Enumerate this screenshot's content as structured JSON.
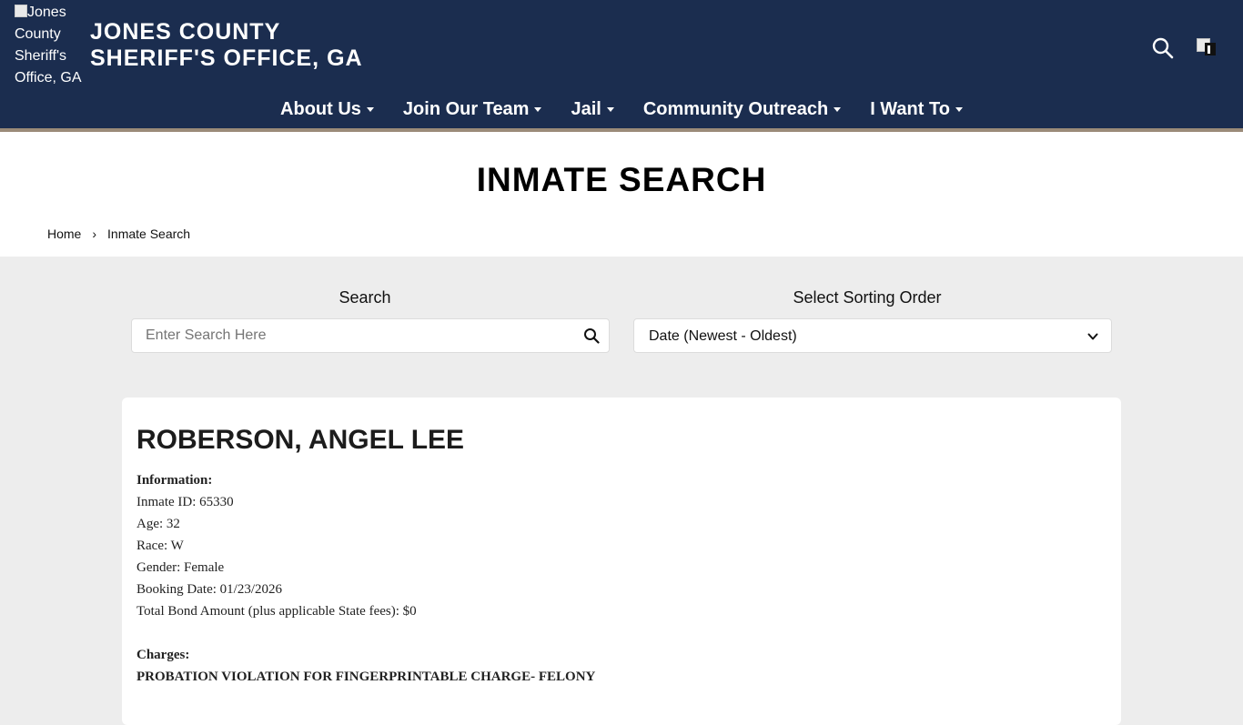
{
  "header": {
    "logo_alt": "Jones County Sheriff's Office, GA",
    "title_line1": "JONES COUNTY",
    "title_line2": "SHERIFF'S OFFICE, GA",
    "search_icon": "search-icon",
    "flag_icon": "broken-image-icon"
  },
  "nav": {
    "items": [
      {
        "label": "About Us"
      },
      {
        "label": "Join Our Team"
      },
      {
        "label": "Jail"
      },
      {
        "label": "Community Outreach"
      },
      {
        "label": "I Want To"
      }
    ]
  },
  "page": {
    "title": "INMATE SEARCH",
    "breadcrumb": {
      "home": "Home",
      "separator": "›",
      "current": "Inmate Search"
    }
  },
  "filters": {
    "search_label": "Search",
    "search_placeholder": "Enter Search Here",
    "search_value": "",
    "sort_label": "Select Sorting Order",
    "sort_value": "Date (Newest - Oldest)"
  },
  "inmate": {
    "name": "ROBERSON, ANGEL LEE",
    "info_heading": "Information:",
    "inmate_id": "Inmate ID: 65330",
    "age": "Age: 32",
    "race": "Race: W",
    "gender": "Gender: Female",
    "booking_date": "Booking Date: 01/23/2026",
    "bond": "Total Bond Amount (plus applicable State fees): $0",
    "charges_heading": "Charges:",
    "charges": [
      "PROBATION VIOLATION FOR FINGERPRINTABLE CHARGE- FELONY"
    ]
  },
  "colors": {
    "header_bg": "#1b2d4f",
    "header_rule": "#9b8b79",
    "page_bg": "#ededed"
  }
}
